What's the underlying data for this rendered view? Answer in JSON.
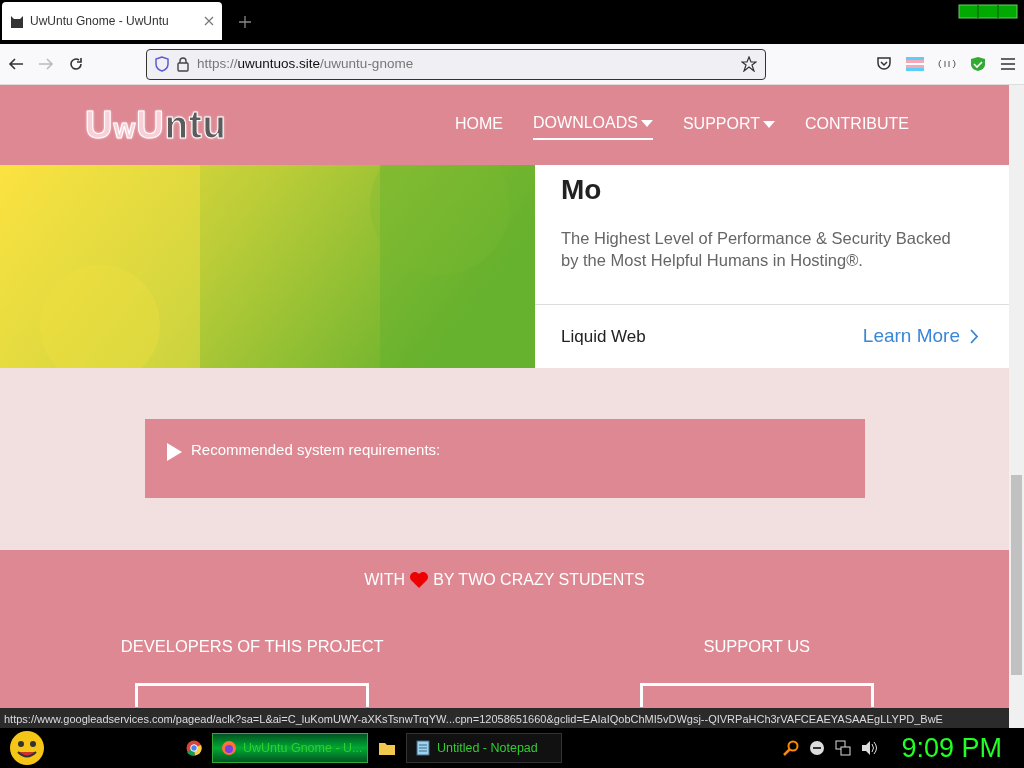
{
  "browser": {
    "tabs": [
      {
        "title": "UwUntu Gnome - UwUntu",
        "selected": true
      }
    ],
    "address": {
      "scheme": "https://",
      "host": "uwuntuos.site",
      "path": "/uwuntu-gnome"
    }
  },
  "site": {
    "logo": "UwUntu",
    "nav": [
      {
        "label": "HOME",
        "selected": false,
        "dropdown": false
      },
      {
        "label": "DOWNLOADS",
        "selected": true,
        "dropdown": true
      },
      {
        "label": "SUPPORT",
        "selected": false,
        "dropdown": true
      },
      {
        "label": "CONTRIBUTE",
        "selected": false,
        "dropdown": false
      }
    ],
    "ad": {
      "heading": "Mo",
      "text": "The Highest Level of Performance & Security Backed by the Most Helpful Humans in Hosting®.",
      "advertiser": "Liquid Web",
      "cta": "Learn More"
    },
    "requirements": {
      "label": "Recommended system requirements:",
      "expanded": false
    },
    "footer": {
      "tagline_before": "WITH",
      "tagline_after": "BY TWO CRAZY STUDENTS",
      "columns": [
        {
          "heading": "DEVELOPERS OF THIS PROJECT"
        },
        {
          "heading": "SUPPORT US"
        }
      ]
    }
  },
  "status_url": "https://www.googleadservices.com/pagead/aclk?sa=L&ai=C_luKomUWY-aXKsTsnwTrqYW...cpn=12058651660&gclid=EAIaIQobChMI5vDWgsj--QIVRPaHCh3rVAFCEAEYASAAEgLLYPD_BwE",
  "taskbar": {
    "items": [
      {
        "label": "UwUntu Gnome - U...",
        "kind": "firefox",
        "selected": true
      },
      {
        "label": "Untitled - Notepad",
        "kind": "notepad",
        "selected": false
      }
    ],
    "clock": "9:09 PM"
  }
}
